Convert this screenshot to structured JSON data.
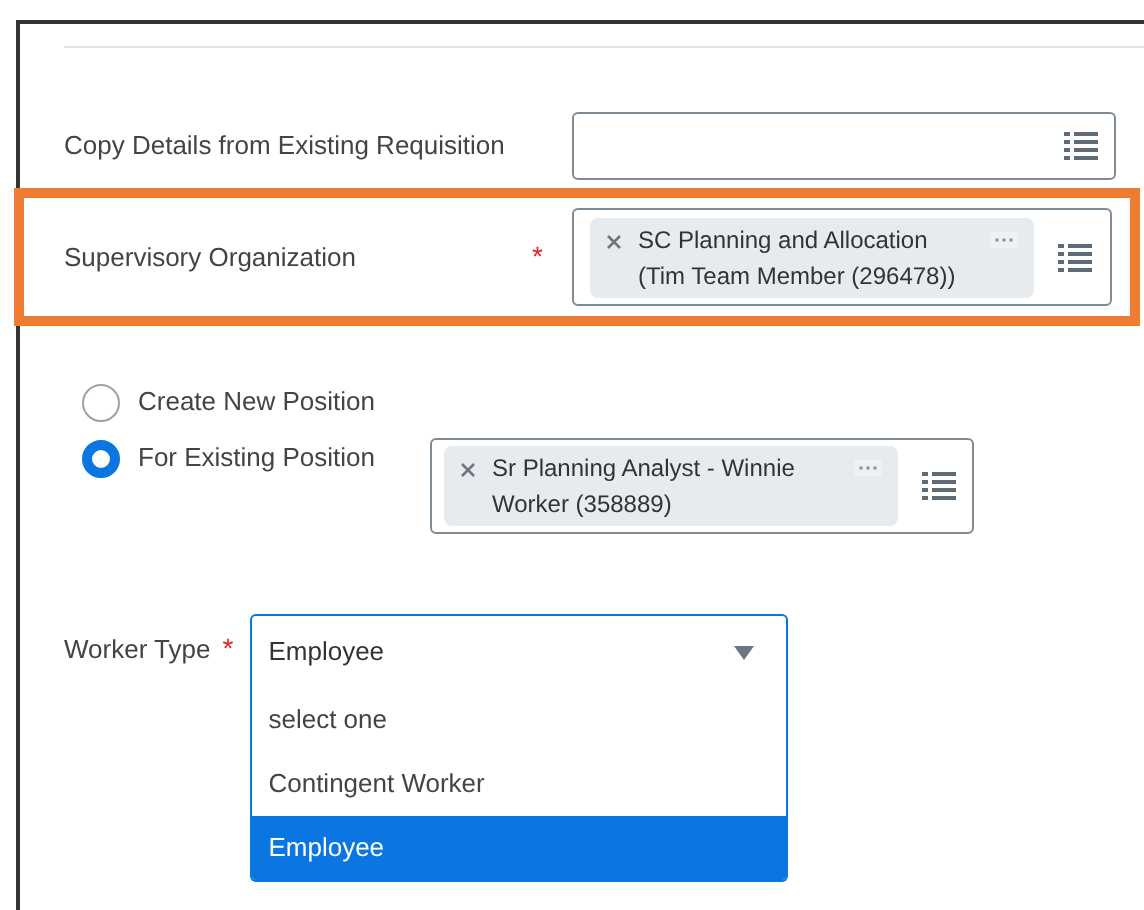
{
  "fields": [
    {
      "label": "Copy Details from Existing Requisition",
      "highlighted": false
    },
    {
      "label": "Supervisory Organization",
      "required_marker": "*",
      "highlighted": true,
      "chip": [
        "SC Planning and Allocation",
        "(Tim Team Member (296478))"
      ]
    }
  ],
  "position_options": [
    {
      "label": "Create New Position",
      "selected": false
    },
    {
      "label": "For Existing Position",
      "selected": true,
      "chip": [
        "Sr Planning Analyst - Winnie",
        "Worker (358889)"
      ]
    }
  ],
  "worker_type": {
    "label": "Worker Type",
    "required_marker": "*",
    "value": "Employee",
    "expanded": true,
    "options": [
      {
        "label": "select one",
        "selected": false
      },
      {
        "label": "Contingent Worker",
        "selected": false
      },
      {
        "label": "Employee",
        "selected": true
      }
    ]
  }
}
